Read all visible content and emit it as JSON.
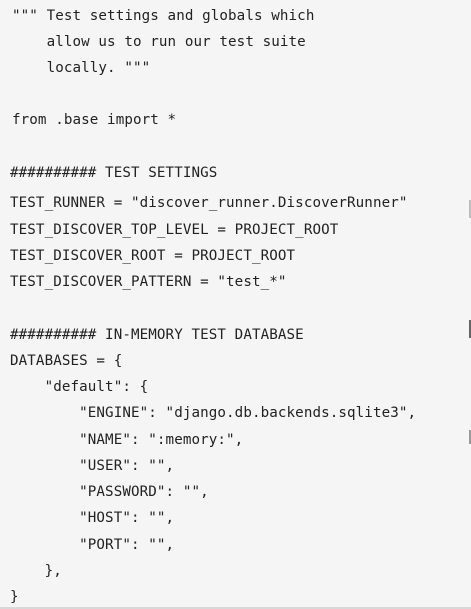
{
  "code": {
    "lines": [
      "\"\"\" Test settings and globals which",
      "    allow us to run our test suite",
      "    locally. \"\"\"",
      "",
      "from .base import *",
      "",
      "########## TEST SETTINGS",
      "TEST_RUNNER = \"discover_runner.DiscoverRunner\"",
      "TEST_DISCOVER_TOP_LEVEL = PROJECT_ROOT",
      "TEST_DISCOVER_ROOT = PROJECT_ROOT",
      "TEST_DISCOVER_PATTERN = \"test_*\"",
      "",
      "########## IN-MEMORY TEST DATABASE",
      "DATABASES = {",
      "    \"default\": {",
      "        \"ENGINE\": \"django.db.backends.sqlite3\",",
      "        \"NAME\": \":memory:\",",
      "        \"USER\": \"\",",
      "        \"PASSWORD\": \"\",",
      "        \"HOST\": \"\",",
      "        \"PORT\": \"\",",
      "    },",
      "}"
    ]
  }
}
